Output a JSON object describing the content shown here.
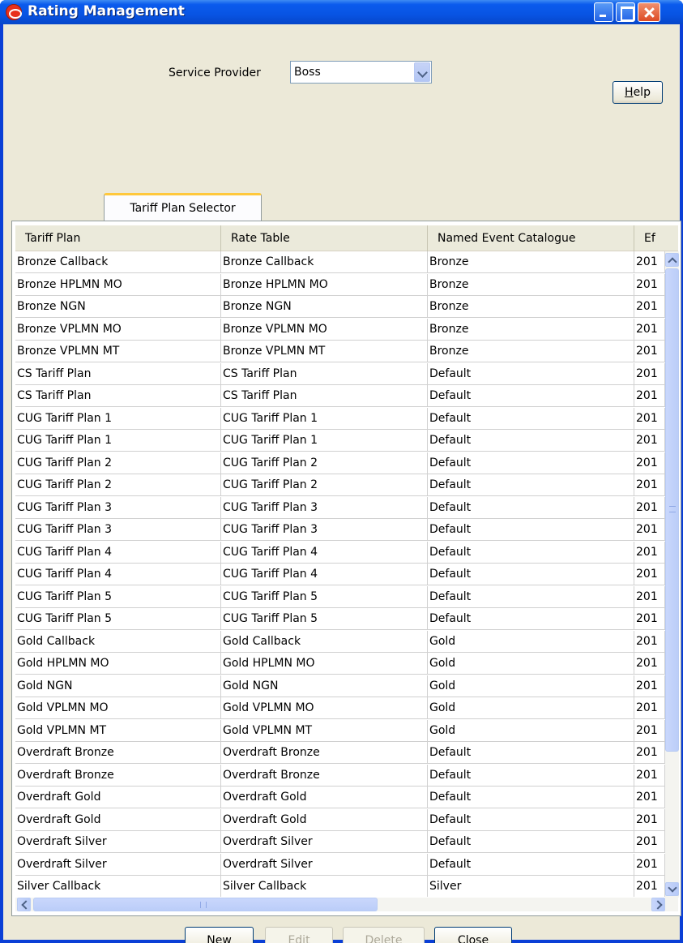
{
  "window": {
    "title": "Rating Management"
  },
  "service_provider": {
    "label": "Service Provider",
    "value": "Boss"
  },
  "help_button": {
    "prefix": "",
    "mnemonic": "H",
    "suffix": "elp"
  },
  "tabs": [
    {
      "label": "Tariff Plan Selector"
    }
  ],
  "table": {
    "columns": [
      "Tariff Plan",
      "Rate Table",
      "Named Event Catalogue",
      "Ef"
    ],
    "rows": [
      [
        "Bronze Callback",
        "Bronze Callback",
        "Bronze",
        "201"
      ],
      [
        "Bronze HPLMN MO",
        "Bronze HPLMN MO",
        "Bronze",
        "201"
      ],
      [
        "Bronze NGN",
        "Bronze NGN",
        "Bronze",
        "201"
      ],
      [
        "Bronze VPLMN MO",
        "Bronze VPLMN MO",
        "Bronze",
        "201"
      ],
      [
        "Bronze VPLMN MT",
        "Bronze VPLMN MT",
        "Bronze",
        "201"
      ],
      [
        "CS Tariff Plan",
        "CS Tariff Plan",
        "Default",
        "201"
      ],
      [
        "CS Tariff Plan",
        "CS Tariff Plan",
        "Default",
        "201"
      ],
      [
        "CUG Tariff Plan 1",
        "CUG Tariff Plan 1",
        "Default",
        "201"
      ],
      [
        "CUG Tariff Plan 1",
        "CUG Tariff Plan 1",
        "Default",
        "201"
      ],
      [
        "CUG Tariff Plan 2",
        "CUG Tariff Plan 2",
        "Default",
        "201"
      ],
      [
        "CUG Tariff Plan 2",
        "CUG Tariff Plan 2",
        "Default",
        "201"
      ],
      [
        "CUG Tariff Plan 3",
        "CUG Tariff Plan 3",
        "Default",
        "201"
      ],
      [
        "CUG Tariff Plan 3",
        "CUG Tariff Plan 3",
        "Default",
        "201"
      ],
      [
        "CUG Tariff Plan 4",
        "CUG Tariff Plan 4",
        "Default",
        "201"
      ],
      [
        "CUG Tariff Plan 4",
        "CUG Tariff Plan 4",
        "Default",
        "201"
      ],
      [
        "CUG Tariff Plan 5",
        "CUG Tariff Plan 5",
        "Default",
        "201"
      ],
      [
        "CUG Tariff Plan 5",
        "CUG Tariff Plan 5",
        "Default",
        "201"
      ],
      [
        "Gold Callback",
        "Gold Callback",
        "Gold",
        "201"
      ],
      [
        "Gold HPLMN MO",
        "Gold HPLMN MO",
        "Gold",
        "201"
      ],
      [
        "Gold NGN",
        "Gold NGN",
        "Gold",
        "201"
      ],
      [
        "Gold VPLMN MO",
        "Gold VPLMN MO",
        "Gold",
        "201"
      ],
      [
        "Gold VPLMN MT",
        "Gold VPLMN MT",
        "Gold",
        "201"
      ],
      [
        "Overdraft Bronze",
        "Overdraft Bronze",
        "Default",
        "201"
      ],
      [
        "Overdraft Bronze",
        "Overdraft Bronze",
        "Default",
        "201"
      ],
      [
        "Overdraft Gold",
        "Overdraft Gold",
        "Default",
        "201"
      ],
      [
        "Overdraft Gold",
        "Overdraft Gold",
        "Default",
        "201"
      ],
      [
        "Overdraft Silver",
        "Overdraft Silver",
        "Default",
        "201"
      ],
      [
        "Overdraft Silver",
        "Overdraft Silver",
        "Default",
        "201"
      ],
      [
        "Silver Callback",
        "Silver Callback",
        "Silver",
        "201"
      ]
    ]
  },
  "buttons": {
    "new": {
      "prefix": "",
      "mnemonic": "N",
      "suffix": "ew",
      "enabled": true
    },
    "edit": {
      "prefix": "",
      "mnemonic": "E",
      "suffix": "dit",
      "enabled": false
    },
    "delete": {
      "prefix": "",
      "mnemonic": "D",
      "suffix": "elete",
      "enabled": false
    },
    "close": {
      "prefix": "",
      "mnemonic": "C",
      "suffix": "lose",
      "enabled": true
    }
  },
  "colors": {
    "titlebar": "#0854e3",
    "client_bg": "#ece9d8",
    "tab_accent": "#ffc83c",
    "app_icon": "#e8301c"
  },
  "icons": [
    "oracle-app-icon",
    "minimize-icon",
    "maximize-icon",
    "close-icon",
    "dropdown-arrow-icon",
    "scroll-up-icon",
    "scroll-down-icon",
    "scroll-left-icon",
    "scroll-right-icon"
  ]
}
